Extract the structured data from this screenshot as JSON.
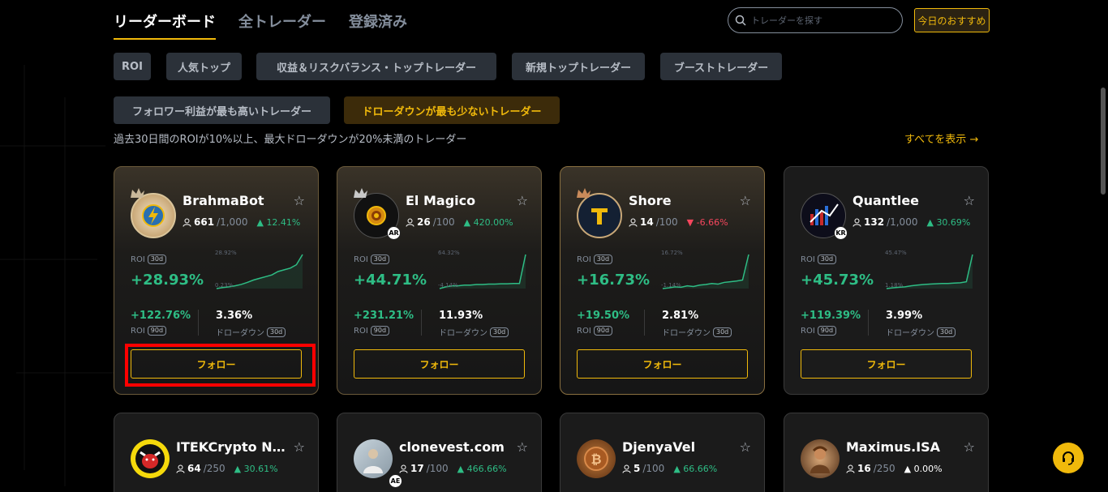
{
  "tabs": [
    {
      "label": "リーダーボード",
      "active": true
    },
    {
      "label": "全トレーダー",
      "active": false
    },
    {
      "label": "登録済み",
      "active": false
    }
  ],
  "search": {
    "placeholder": "トレーダーを探す",
    "icon": "search-icon"
  },
  "recommend_label": "今日のおすすめ",
  "chips": [
    {
      "label": "ROI",
      "active": false
    },
    {
      "label": "人気トップ",
      "active": false
    },
    {
      "label": "収益＆リスクバランス・トップトレーダー",
      "active": false
    },
    {
      "label": "新規トップトレーダー",
      "active": false
    },
    {
      "label": "ブーストトレーダー",
      "active": false
    },
    {
      "label": "フォロワー利益が最も高いトレーダー",
      "active": false
    },
    {
      "label": "ドローダウンが最も少ないトレーダー",
      "active": true
    }
  ],
  "description": "過去30日間のROIが10%以上、最大ドローダウンが20%未満のトレーダー",
  "show_all": "すべてを表示 →",
  "labels": {
    "roi": "ROI",
    "d30": "30d",
    "d90": "90d",
    "drawdown": "ドローダウン",
    "follow": "フォロー"
  },
  "colors": {
    "accent": "#f0b90b",
    "up": "#2ebd85",
    "down": "#f6465d"
  },
  "traders": [
    {
      "name": "BrahmaBot",
      "followers": "661",
      "capacity": "/1,000",
      "change": "12.41%",
      "change_dir": "up",
      "roi30": "+28.93%",
      "chart_hi": "28.92%",
      "chart_lo": "0.23%",
      "roi90": "+122.76%",
      "drawdown": "3.36%",
      "region": "",
      "crown": true,
      "avatar_icon": "lightning-gear-icon",
      "spark": [
        0.0,
        0.03,
        0.05,
        0.08,
        0.12,
        0.18,
        0.25,
        0.3,
        0.35,
        0.4,
        0.5,
        0.55,
        0.6,
        0.7,
        1.0
      ]
    },
    {
      "name": "El Magico",
      "followers": "26",
      "capacity": "/100",
      "change": "420.00%",
      "change_dir": "up",
      "roi30": "+44.71%",
      "chart_hi": "64.32%",
      "chart_lo": "-4.14%",
      "roi90": "+231.21%",
      "drawdown": "11.93%",
      "region": "AR",
      "crown": true,
      "avatar_icon": "coin-icon",
      "spark": [
        0.0,
        0.05,
        0.08,
        0.08,
        0.1,
        0.1,
        0.12,
        0.12,
        0.13,
        0.13,
        0.14,
        0.14,
        0.15,
        0.15,
        1.0
      ]
    },
    {
      "name": "Shore",
      "followers": "14",
      "capacity": "/100",
      "change": "-6.66%",
      "change_dir": "down",
      "roi30": "+16.73%",
      "chart_hi": "16.72%",
      "chart_lo": "-1.14%",
      "roi90": "+19.50%",
      "drawdown": "2.81%",
      "region": "",
      "crown": true,
      "avatar_icon": "t-logo-icon",
      "spark": [
        0.0,
        0.02,
        0.05,
        0.04,
        0.08,
        0.06,
        0.1,
        0.12,
        0.15,
        0.13,
        0.18,
        0.2,
        0.22,
        0.25,
        1.0
      ]
    },
    {
      "name": "Quantlee",
      "followers": "132",
      "capacity": "/1,000",
      "change": "30.69%",
      "change_dir": "up",
      "roi30": "+45.73%",
      "chart_hi": "45.47%",
      "chart_lo": "1.18%",
      "roi90": "+119.39%",
      "drawdown": "3.99%",
      "region": "KR",
      "crown": false,
      "avatar_icon": "chart-logo-icon",
      "spark": [
        0.0,
        0.02,
        0.04,
        0.05,
        0.08,
        0.1,
        0.12,
        0.13,
        0.14,
        0.15,
        0.15,
        0.16,
        0.17,
        0.2,
        1.0
      ]
    },
    {
      "name": "ITEKCrypto Ni...",
      "followers": "64",
      "capacity": "/250",
      "change": "30.61%",
      "change_dir": "up",
      "region": "",
      "crown": false,
      "avatar_icon": "bull-icon"
    },
    {
      "name": "clonevest.com",
      "followers": "17",
      "capacity": "/100",
      "change": "466.66%",
      "change_dir": "up",
      "region": "AE",
      "crown": false,
      "avatar_icon": "photo-avatar-icon"
    },
    {
      "name": "DjenyaVel",
      "followers": "5",
      "capacity": "/100",
      "change": "66.66%",
      "change_dir": "up",
      "region": "",
      "crown": false,
      "avatar_icon": "bitcoin-icon"
    },
    {
      "name": "Maximus.ISA",
      "followers": "16",
      "capacity": "/250",
      "change": "0.00%",
      "change_dir": "flat",
      "region": "",
      "crown": false,
      "avatar_icon": "gladiator-icon"
    }
  ]
}
